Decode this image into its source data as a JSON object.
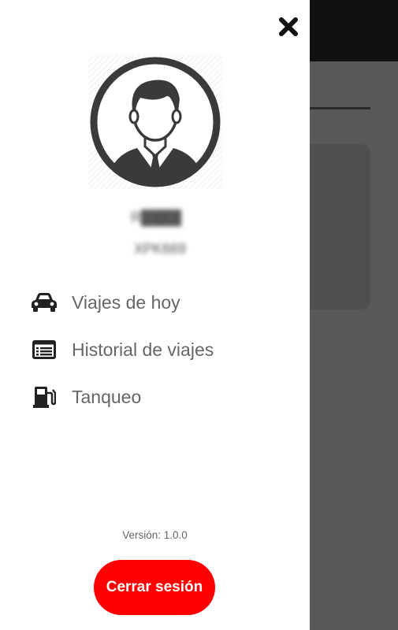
{
  "drawer": {
    "close_icon": "close-icon",
    "avatar_icon": "user-avatar-icon",
    "user": {
      "name": "R████",
      "plate": "XPK669"
    },
    "menu": [
      {
        "label": "Viajes de hoy",
        "icon": "car-icon"
      },
      {
        "label": "Historial de viajes",
        "icon": "list-icon"
      },
      {
        "label": "Tanqueo",
        "icon": "gas-pump-icon"
      }
    ],
    "version": "Versión: 1.0.0",
    "logout_label": "Cerrar sesión"
  },
  "colors": {
    "accent": "#ff0000",
    "overlay": "#585858",
    "topbar": "#111111",
    "menu_text": "#666666",
    "icon": "#222222"
  }
}
